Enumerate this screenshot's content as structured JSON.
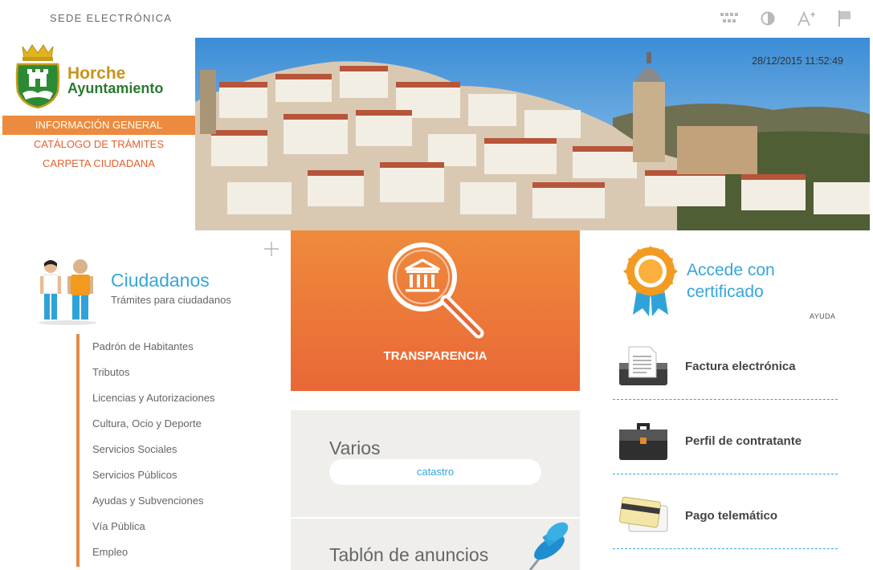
{
  "header": {
    "site_label": "SEDE ELECTRÓNICA",
    "icons": [
      "sitemap-icon",
      "contrast-icon",
      "font-size-icon",
      "language-flag-icon"
    ]
  },
  "logo": {
    "line1": "Horche",
    "line2": "Ayuntamiento"
  },
  "nav": {
    "items": [
      {
        "label": "INFORMACIÓN GENERAL",
        "active": true
      },
      {
        "label": "CATÁLOGO DE TRÁMITES",
        "active": false
      },
      {
        "label": "CARPETA CIUDADANA",
        "active": false
      }
    ]
  },
  "hero": {
    "datetime": "28/12/2015 11:52:49"
  },
  "ciudadanos": {
    "title": "Ciudadanos",
    "subtitle": "Trámites para ciudadanos",
    "items": [
      "Padrón de Habitantes",
      "Tributos",
      "Licencias y Autorizaciones",
      "Cultura, Ocio y Deporte",
      "Servicios Sociales",
      "Servicios Públicos",
      "Ayudas y Subvenciones",
      "Vía Pública",
      "Empleo"
    ]
  },
  "transparencia": {
    "label": "TRANSPARENCIA"
  },
  "varios": {
    "title": "Varios",
    "button": "catastro"
  },
  "tablon": {
    "title": "Tablón de anuncios"
  },
  "certificado": {
    "title": "Accede con certificado",
    "help": "AYUDA"
  },
  "services": [
    {
      "label": "Factura electrónica",
      "icon": "invoice-printer-icon"
    },
    {
      "label": "Perfil de contratante",
      "icon": "briefcase-icon"
    },
    {
      "label": "Pago telemático",
      "icon": "credit-cards-icon"
    }
  ],
  "colors": {
    "accent_orange": "#ec8b3f",
    "accent_blue": "#36a5db",
    "nav_text": "#e1612f"
  }
}
